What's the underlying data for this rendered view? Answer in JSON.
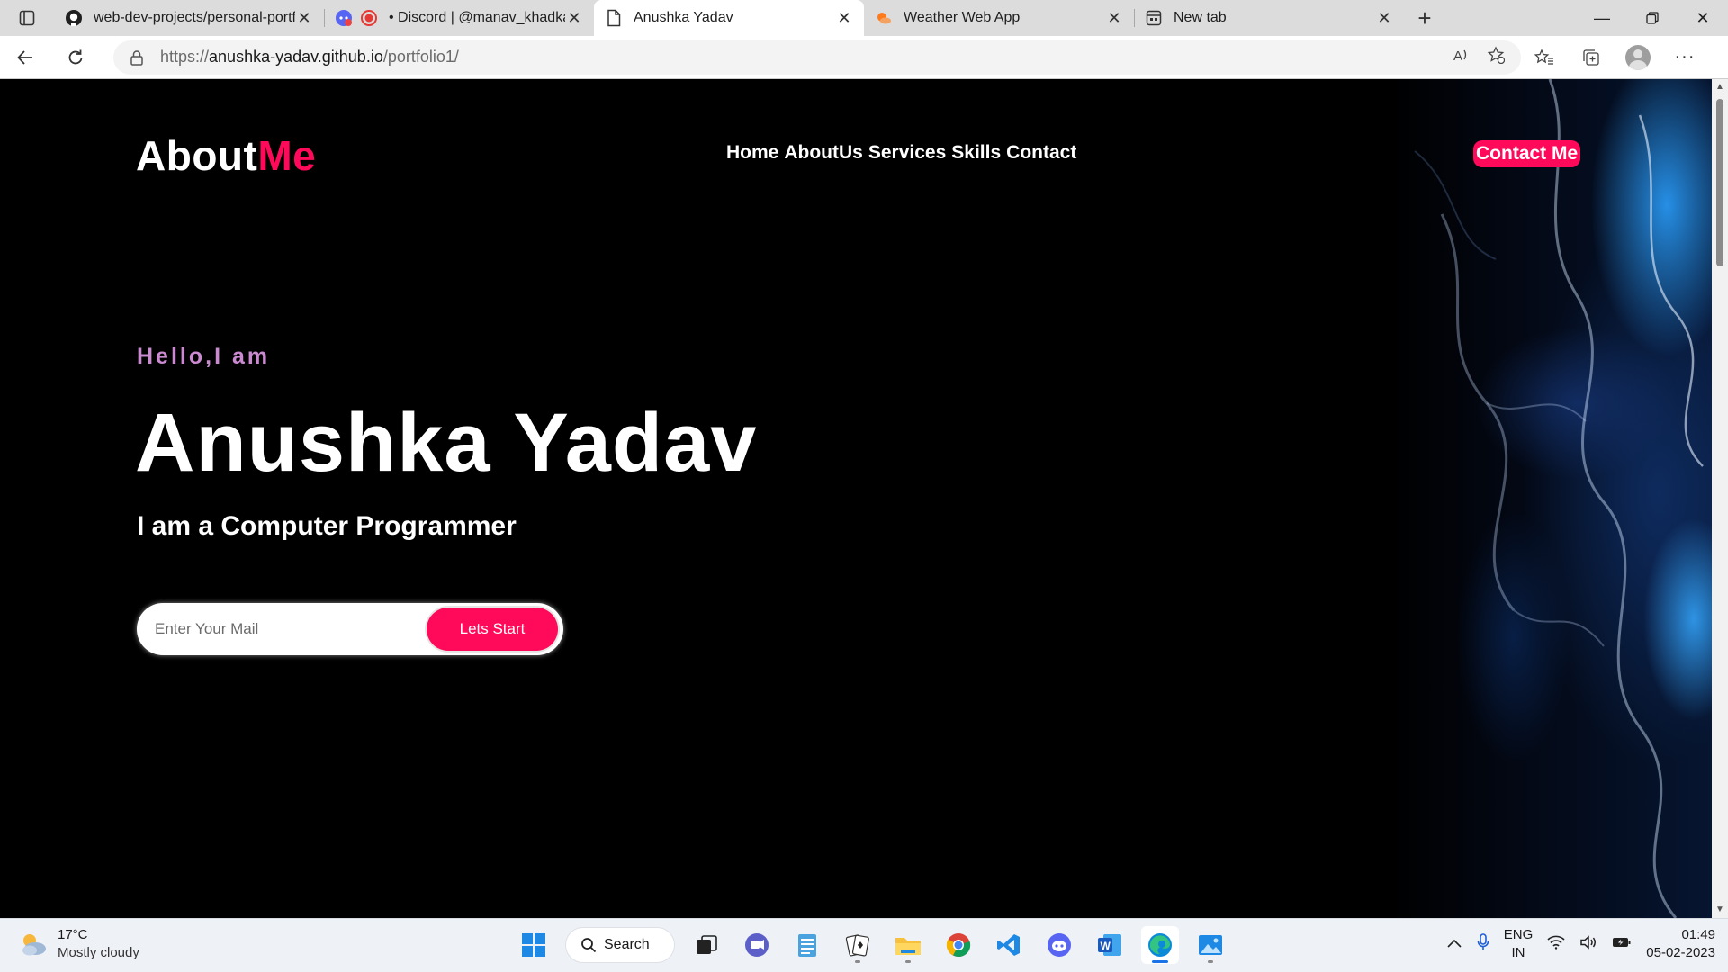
{
  "browser": {
    "tabs": [
      {
        "title": "web-dev-projects/personal-portf",
        "favicon": "github-icon",
        "active": false
      },
      {
        "title": "• Discord | @manav_khadka",
        "favicon": "discord-icon",
        "active": false
      },
      {
        "title": "Anushka Yadav",
        "favicon": "page-icon",
        "active": true
      },
      {
        "title": "Weather Web App",
        "favicon": "weather-icon",
        "active": false
      },
      {
        "title": "New tab",
        "favicon": "newtab-icon",
        "active": false
      }
    ],
    "url": {
      "scheme": "https://",
      "host": "anushka-yadav.github.io",
      "path": "/portfolio1/"
    }
  },
  "page": {
    "brand": {
      "main": "About",
      "accent": "Me"
    },
    "nav": [
      "Home",
      "AboutUs",
      "Services",
      "Skills",
      "Contact"
    ],
    "contact_button": "Contact Me",
    "hello": "Hello,I am",
    "name": "Anushka Yadav",
    "role": "I am a Computer Programmer",
    "mail_placeholder": "Enter Your Mail",
    "start_button": "Lets Start",
    "colors": {
      "accent": "#ff0a5a",
      "hello": "#c98ad0",
      "background": "#000000"
    }
  },
  "taskbar": {
    "weather": {
      "temp": "17°C",
      "condition": "Mostly cloudy"
    },
    "search_label": "Search",
    "apps": [
      "start-icon",
      "search",
      "task-view-icon",
      "teams-icon",
      "notepad-icon",
      "solitaire-icon",
      "file-explorer-icon",
      "chrome-icon",
      "vscode-icon",
      "discord-icon",
      "word-icon",
      "edge-icon",
      "photos-icon"
    ],
    "language": {
      "line1": "ENG",
      "line2": "IN"
    },
    "time": "01:49",
    "date": "05-02-2023"
  }
}
